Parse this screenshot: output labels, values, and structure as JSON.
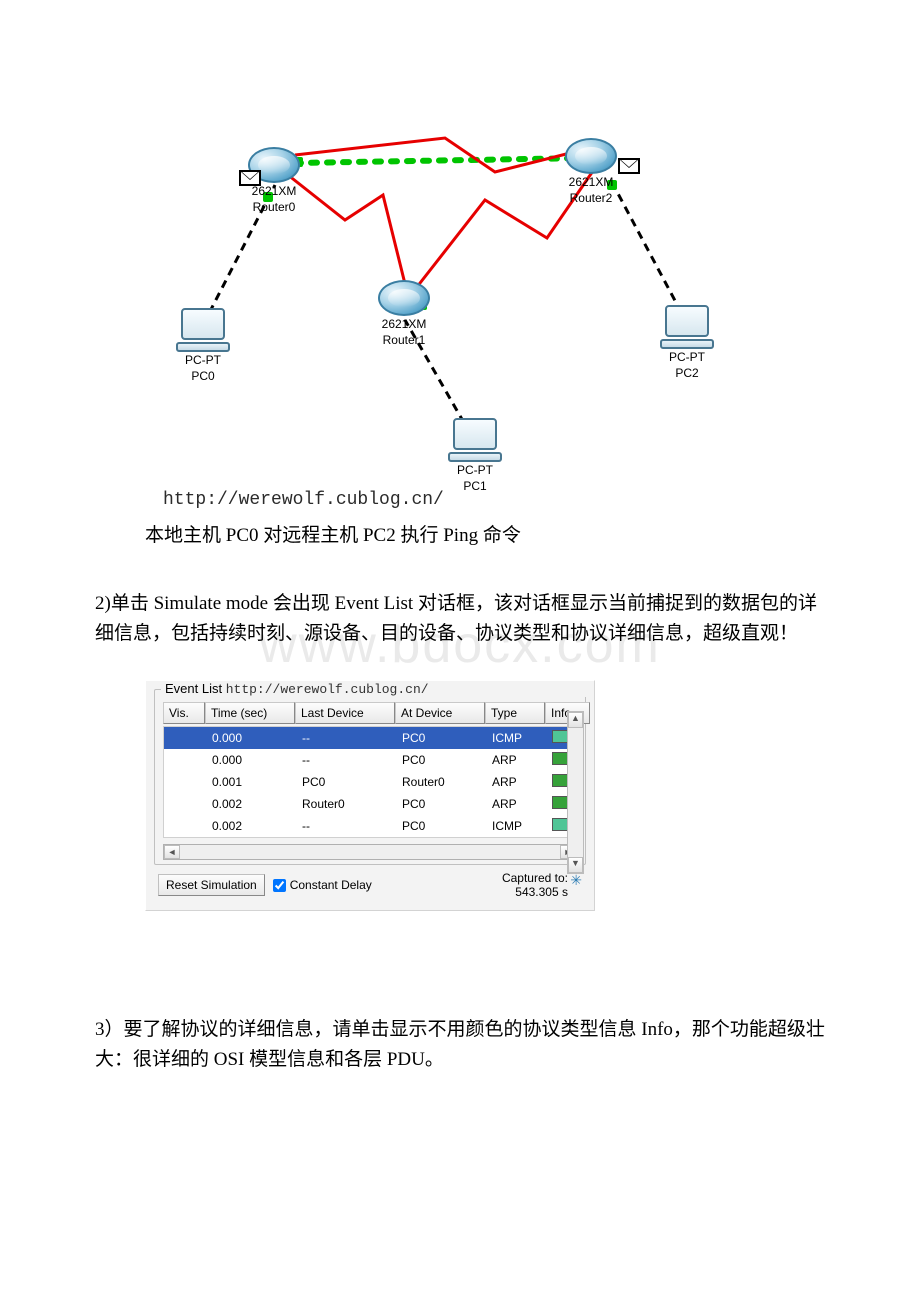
{
  "bg_watermark": "www.bdocx.com",
  "diagram": {
    "routers": [
      {
        "id": "r0",
        "model": "2621XM",
        "name": "Router0"
      },
      {
        "id": "r1",
        "model": "2621XM",
        "name": "Router1"
      },
      {
        "id": "r2",
        "model": "2621XM",
        "name": "Router2"
      }
    ],
    "pcs": [
      {
        "id": "pc0",
        "type": "PC-PT",
        "name": "PC0"
      },
      {
        "id": "pc1",
        "type": "PC-PT",
        "name": "PC1"
      },
      {
        "id": "pc2",
        "type": "PC-PT",
        "name": "PC2"
      }
    ],
    "url": "http://werewolf.cublog.cn/"
  },
  "caption1": "本地主机 PC0 对远程主机 PC2 执行 Ping 命令",
  "para2": "2)单击 Simulate mode 会出现 Event List 对话框，该对话框显示当前捕捉到的数据包的详细信息，包括持续时刻、源设备、目的设备、协议类型和协议详细信息，超级直观！",
  "event_panel": {
    "title": "Event List",
    "url": "http://werewolf.cublog.cn/",
    "headers": {
      "vis": "Vis.",
      "time": "Time (sec)",
      "last": "Last Device",
      "at": "At Device",
      "type": "Type",
      "info": "Info"
    },
    "rows": [
      {
        "time": "0.000",
        "last": "--",
        "at": "PC0",
        "type": "ICMP",
        "swatch": "teal",
        "selected": true
      },
      {
        "time": "0.000",
        "last": "--",
        "at": "PC0",
        "type": "ARP",
        "swatch": "green",
        "selected": false
      },
      {
        "time": "0.001",
        "last": "PC0",
        "at": "Router0",
        "type": "ARP",
        "swatch": "green",
        "selected": false
      },
      {
        "time": "0.002",
        "last": "Router0",
        "at": "PC0",
        "type": "ARP",
        "swatch": "green",
        "selected": false
      },
      {
        "time": "0.002",
        "last": "--",
        "at": "PC0",
        "type": "ICMP",
        "swatch": "teal",
        "selected": false
      }
    ],
    "reset": "Reset Simulation",
    "constant_delay": "Constant Delay",
    "captured_to_label": "Captured to:",
    "captured_to_value": "543.305 s"
  },
  "para3": "3）要了解协议的详细信息，请单击显示不用颜色的协议类型信息 Info，那个功能超级壮大：很详细的 OSI 模型信息和各层 PDU。"
}
